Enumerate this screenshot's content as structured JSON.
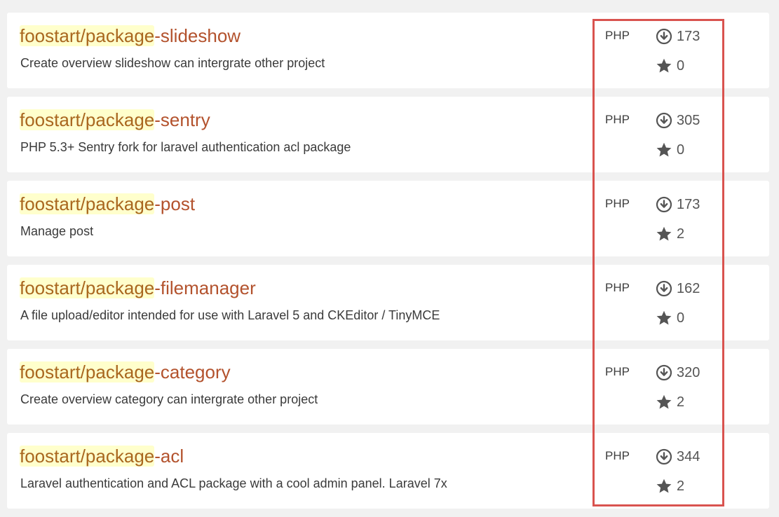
{
  "packages": [
    {
      "name_prefix": "foostart/package",
      "name_suffix": "-slideshow",
      "description": "Create overview slideshow can intergrate other project",
      "language": "PHP",
      "downloads": "173",
      "stars": "0"
    },
    {
      "name_prefix": "foostart/package",
      "name_suffix": "-sentry",
      "description": "PHP 5.3+ Sentry fork for laravel authentication acl package",
      "language": "PHP",
      "downloads": "305",
      "stars": "0"
    },
    {
      "name_prefix": "foostart/package",
      "name_suffix": "-post",
      "description": "Manage post",
      "language": "PHP",
      "downloads": "173",
      "stars": "2"
    },
    {
      "name_prefix": "foostart/package",
      "name_suffix": "-filemanager",
      "description": "A file upload/editor intended for use with Laravel 5 and CKEditor / TinyMCE",
      "language": "PHP",
      "downloads": "162",
      "stars": "0"
    },
    {
      "name_prefix": "foostart/package",
      "name_suffix": "-category",
      "description": "Create overview category can intergrate other project",
      "language": "PHP",
      "downloads": "320",
      "stars": "2"
    },
    {
      "name_prefix": "foostart/package",
      "name_suffix": "-acl",
      "description": "Laravel authentication and ACL package with a cool admin panel. Laravel 7x",
      "language": "PHP",
      "downloads": "344",
      "stars": "2"
    }
  ],
  "icons": {
    "downloads": "download-circle-icon",
    "stars": "star-icon"
  },
  "colors": {
    "title": "#b3522d",
    "highlight_bg": "#ffffcc",
    "annotation_border": "#d9534f"
  }
}
